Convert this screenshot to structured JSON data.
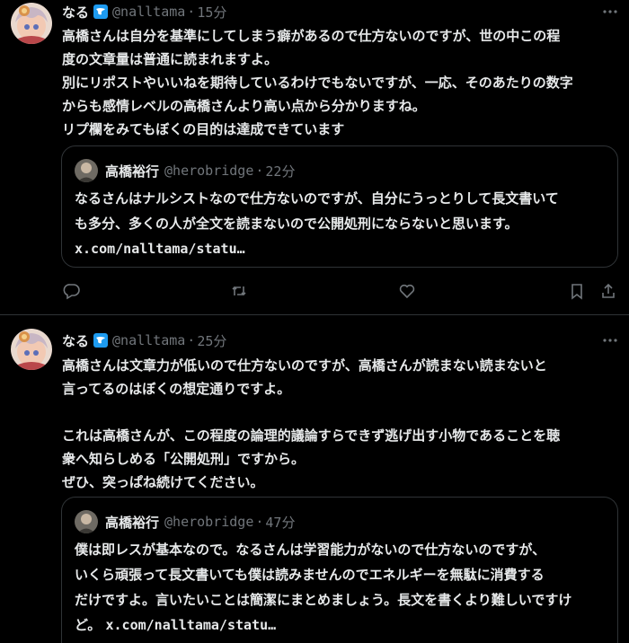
{
  "colors": {
    "background": "#000000",
    "text": "#e7e9ea",
    "muted": "#71767b",
    "border": "#2f3336",
    "verified_blue": "#1d9bf0"
  },
  "tweets": [
    {
      "name": "なる",
      "handle": "@nalltama",
      "separator": "·",
      "time": "15分",
      "lines": [
        "高橋さんは自分を基準にしてしまう癖があるので仕方ないのですが、世の中この程",
        "度の文章量は普通に読まれますよ。",
        "別にリポストやいいねを期待しているわけでもないですが、一応、そのあたりの数字",
        "からも感情レベルの高橋さんより高い点から分かりますね。",
        "リプ欄をみてもぼくの目的は達成できています"
      ],
      "quote": {
        "name": "高橋裕行",
        "handle": "@herobridge",
        "separator": "·",
        "time": "22分",
        "lines": [
          "なるさんはナルシストなので仕方ないのですが、自分にうっとりして長文書いて",
          "も多分、多くの人が全文を読まないので公開処刑にならないと思います。"
        ],
        "link": "x.com/nalltama/statu…"
      }
    },
    {
      "name": "なる",
      "handle": "@nalltama",
      "separator": "·",
      "time": "25分",
      "lines": [
        "高橋さんは文章力が低いので仕方ないのですが、高橋さんが読まない読まないと",
        "言ってるのはぼくの想定通りですよ。",
        "",
        "これは高橋さんが、この程度の論理的議論すらできず逃げ出す小物であることを聴",
        "衆へ知らしめる「公開処刑」ですから。",
        "ぜひ、突っぱね続けてください。"
      ],
      "quote": {
        "name": "高橋裕行",
        "handle": "@herobridge",
        "separator": "·",
        "time": "47分",
        "lines": [
          "僕は即レスが基本なので。なるさんは学習能力がないので仕方ないのですが、",
          "いくら頑張って長文書いても僕は読みませんのでエネルギーを無駄に消費する",
          "だけですよ。言いたいことは簡潔にまとめましょう。長文を書くより難しいですけ"
        ],
        "last_line_prefix": "ど。 ",
        "link": "x.com/nalltama/statu…"
      }
    }
  ]
}
